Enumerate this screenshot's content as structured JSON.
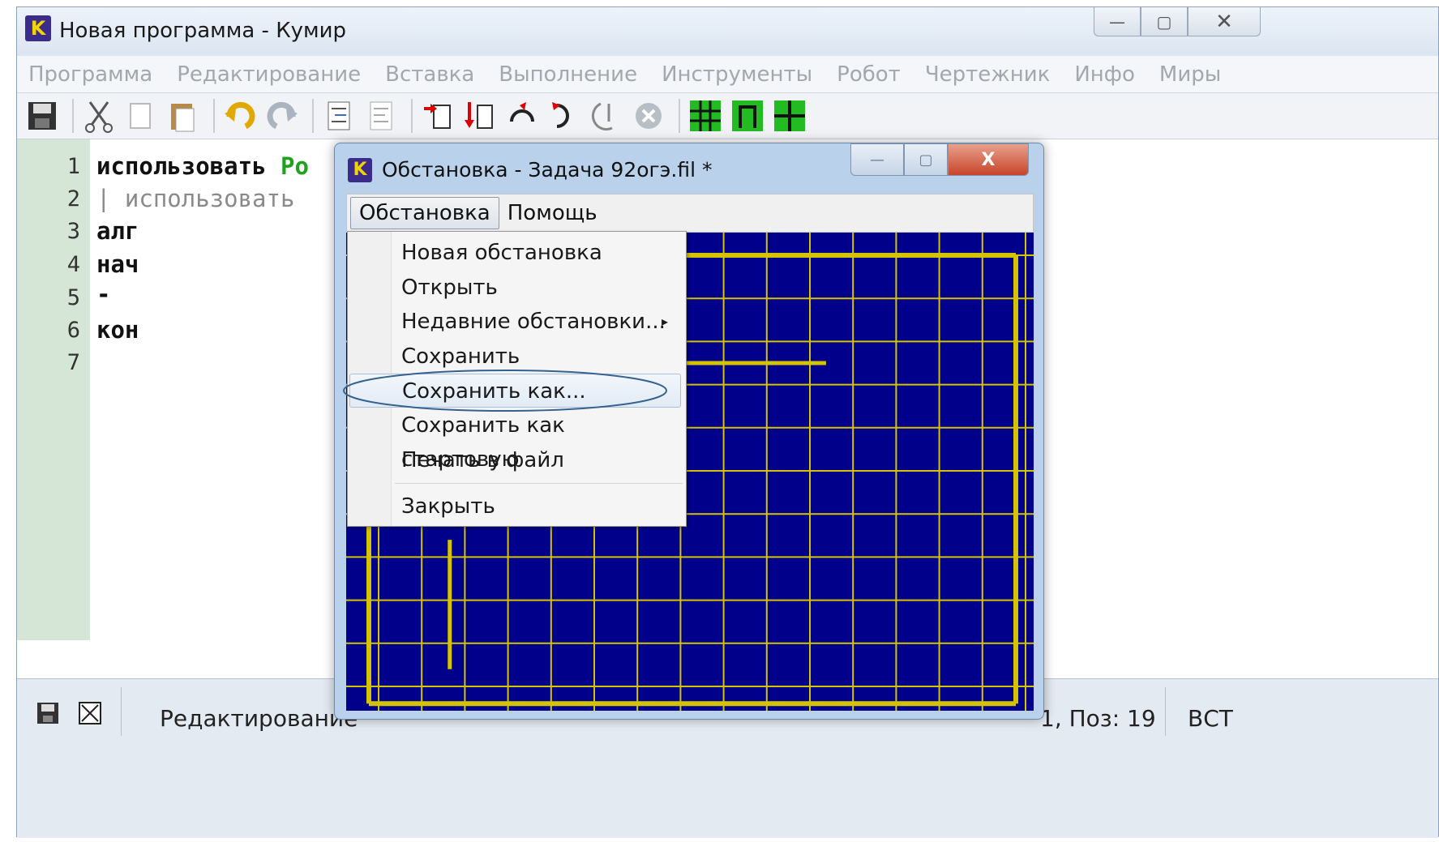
{
  "main_window": {
    "title": "Новая программа - Кумир",
    "app_icon_letter": "K",
    "controls": {
      "minimize": "—",
      "maximize": "▢",
      "close": "✕"
    }
  },
  "menubar": {
    "items": [
      "Программа",
      "Редактирование",
      "Вставка",
      "Выполнение",
      "Инструменты",
      "Робот",
      "Чертежник",
      "Инфо",
      "Миры"
    ]
  },
  "toolbar": {
    "buttons": [
      "save-icon",
      "cut-icon",
      "copy-icon",
      "paste-icon",
      "undo-icon",
      "redo-icon",
      "indent-icon",
      "unindent-icon",
      "step-over-icon",
      "step-into-icon",
      "step-out-icon",
      "step-back-icon",
      "run-icon",
      "stop-icon",
      "robot-grid-icon",
      "robot-wall-icon",
      "robot-cross-icon"
    ]
  },
  "editor": {
    "lines": [
      {
        "num": "1",
        "text": "использовать ",
        "green": "Ро"
      },
      {
        "num": "2",
        "text": "| использовать"
      },
      {
        "num": "3",
        "text": "алг"
      },
      {
        "num": "4",
        "text": "нач"
      },
      {
        "num": "5",
        "text": "-"
      },
      {
        "num": "6",
        "text": "кон"
      },
      {
        "num": "7",
        "text": ""
      }
    ]
  },
  "statusbar": {
    "mode": "Редактирование",
    "position": "1, Поз: 19",
    "insert_mode": "ВСТ"
  },
  "dialog": {
    "title": "Обстановка - Задача 92огэ.fil *",
    "app_icon_letter": "K",
    "close_label": "X",
    "menu": {
      "active": "Обстановка",
      "help": "Помощь"
    },
    "colors": {
      "field": "#00008b",
      "grid": "#d4c400",
      "wall": "#d4c400"
    }
  },
  "dropdown": {
    "items": [
      "Новая обстановка",
      "Открыть",
      "Недавние обстановки...",
      "Сохранить",
      "Сохранить как...",
      "Сохранить как стартовую",
      "Печать в файл",
      "Закрыть"
    ],
    "submenu_arrow": "▸",
    "highlighted": "Сохранить как..."
  }
}
